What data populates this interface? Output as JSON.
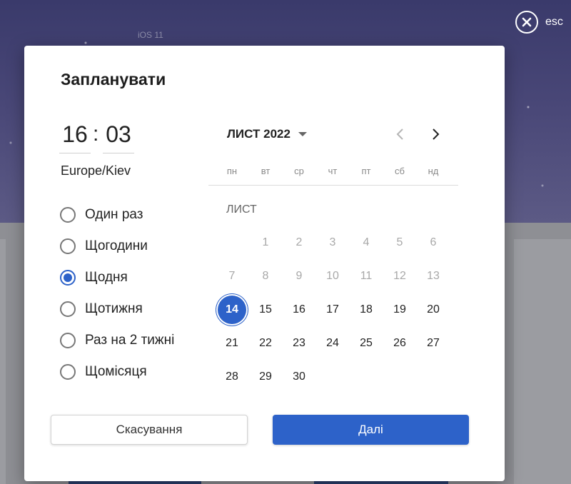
{
  "background": {
    "ios_label": "iOS 11"
  },
  "close": {
    "label": "esc",
    "icon": "close-icon"
  },
  "modal": {
    "title": "Запланувати",
    "time": {
      "hours": "16",
      "separator": ":",
      "minutes": "03"
    },
    "timezone": "Europe/Kiev",
    "frequency": {
      "selected": "Щодня",
      "options": [
        "Один раз",
        "Щогодини",
        "Щодня",
        "Щотижня",
        "Раз на 2 тижні",
        "Щомісяця"
      ]
    },
    "calendar": {
      "header": "ЛИСТ 2022",
      "dropdown_icon": "caret-down-icon",
      "prev_icon": "chevron-left-icon",
      "next_icon": "chevron-right-icon",
      "weekdays": [
        "пн",
        "вт",
        "ср",
        "чт",
        "пт",
        "сб",
        "нд"
      ],
      "month_name": "ЛИСТ",
      "selected_day": "14",
      "days": [
        [
          "",
          "1",
          "2",
          "3",
          "4",
          "5",
          "6"
        ],
        [
          "7",
          "8",
          "9",
          "10",
          "11",
          "12",
          "13"
        ],
        [
          "14",
          "15",
          "16",
          "17",
          "18",
          "19",
          "20"
        ],
        [
          "21",
          "22",
          "23",
          "24",
          "25",
          "26",
          "27"
        ],
        [
          "28",
          "29",
          "30",
          "",
          "",
          "",
          ""
        ]
      ]
    },
    "buttons": {
      "cancel": "Скасування",
      "next": "Далі"
    },
    "colors": {
      "accent": "#2d62c9"
    }
  }
}
